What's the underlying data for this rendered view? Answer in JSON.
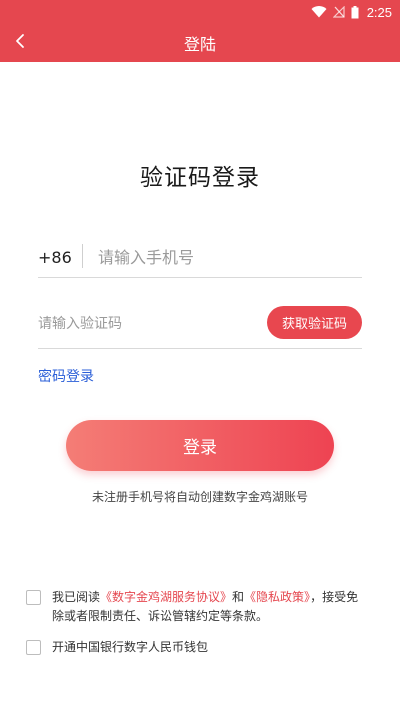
{
  "status_bar": {
    "time": "2:25",
    "icons": [
      "wifi-icon",
      "no-signal-icon",
      "battery-icon"
    ]
  },
  "header": {
    "back_icon": "chevron-left-icon",
    "title": "登陆"
  },
  "main": {
    "heading": "验证码登录",
    "phone": {
      "country_code": "+86",
      "placeholder": "请输入手机号",
      "value": ""
    },
    "code": {
      "placeholder": "请输入验证码",
      "value": "",
      "get_code_label": "获取验证码"
    },
    "password_login_link": "密码登录",
    "login_label": "登录",
    "auto_register_note": "未注册手机号将自动创建数字金鸡湖账号"
  },
  "agreement": {
    "checked": false,
    "prefix": "我已阅读",
    "service_agreement": "《数字金鸡湖服务协议》",
    "and": "和",
    "privacy_policy": "《隐私政策》",
    "suffix": "，接受免除或者限制责任、诉讼管辖约定等条款。"
  },
  "wallet": {
    "checked": false,
    "label": "开通中国银行数字人民币钱包"
  },
  "colors": {
    "brand_red": "#e5474f",
    "link_blue": "#2b5fd8",
    "button_gradient_start": "#f47d76",
    "button_gradient_end": "#ee4352"
  }
}
